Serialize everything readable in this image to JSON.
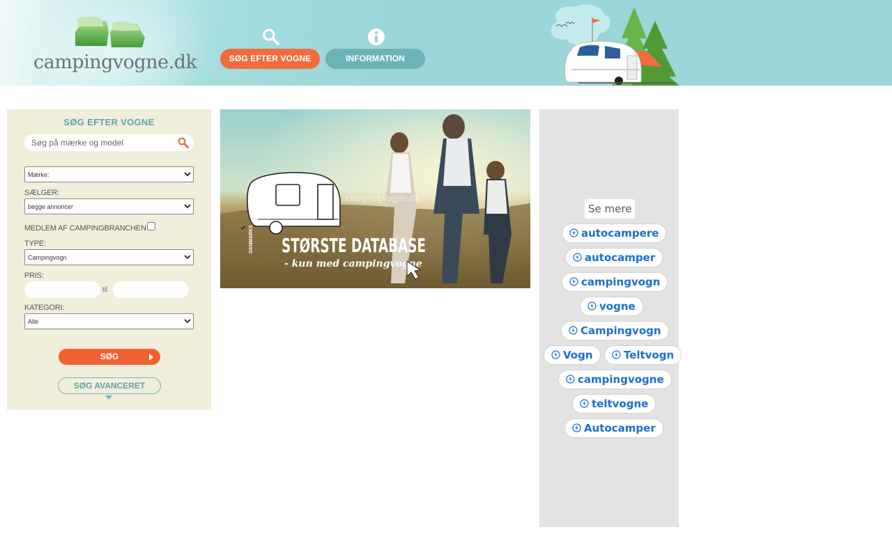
{
  "header": {
    "logo_text": "campingvogne.dk",
    "nav": [
      {
        "label": "SØG EFTER VOGNE",
        "icon": "search-icon"
      },
      {
        "label": "INFORMATION",
        "icon": "info-icon"
      }
    ]
  },
  "search_panel": {
    "title": "SØG EFTER VOGNE",
    "quick_search_placeholder": "Søg på mærke og model",
    "brand_select": "Mærke:",
    "seller_label": "SÆLGER:",
    "seller_select": "begge annoncer",
    "member_label": "MEDLEM AF CAMPINGBRANCHEN",
    "type_label": "TYPE:",
    "type_select": "Campingvogn",
    "price_label": "PRIS:",
    "price_to": "til",
    "category_label": "KATEGORI:",
    "category_select": "Alle",
    "search_button": "SØG",
    "advanced_button": "SØG AVANCERET"
  },
  "banner": {
    "line1_small": "DANMARKS",
    "line1": "STØRSTE DATABASE",
    "line2": "- kun med campingvogne",
    "watermark": "campingvogne.dk"
  },
  "ad": {
    "see_more": "Se mere",
    "chips": [
      "autocampere",
      "autocamper",
      "campingvogn",
      "vogne",
      "Campingvogn",
      "Vogn",
      "Teltvogn",
      "campingvogne",
      "teltvogne",
      "Autocamper"
    ]
  },
  "colors": {
    "accent_orange": "#f26131",
    "accent_teal": "#6cb3b5",
    "panel_bg": "#f2eedc",
    "chip_text": "#1a6fd2"
  }
}
